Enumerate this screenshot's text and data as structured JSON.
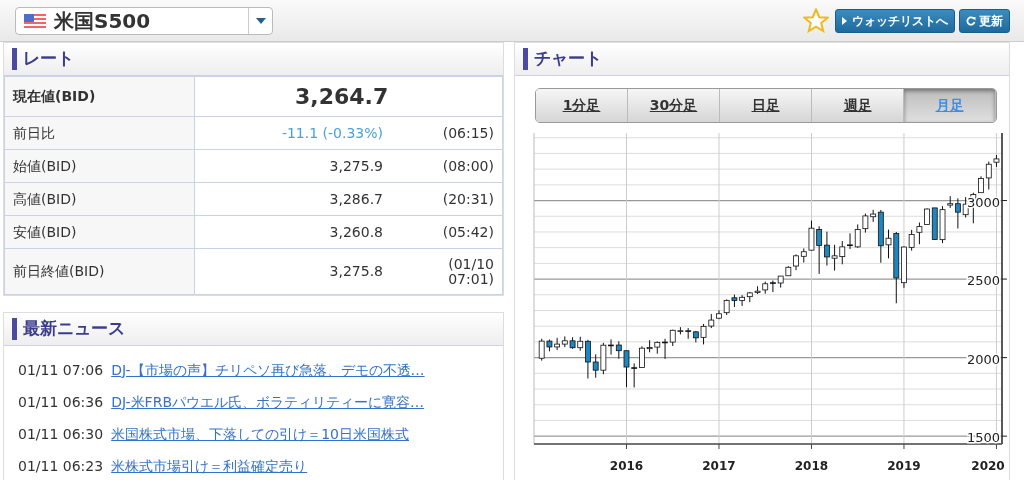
{
  "header": {
    "instrument": "米国S500",
    "watchlist_button": "ウォッチリストへ",
    "refresh_button": "更新"
  },
  "rate": {
    "title": "レート",
    "current": {
      "label": "現在値(BID)",
      "value": "3,264.7"
    },
    "rows": [
      {
        "label": "前日比",
        "value": "-11.1 (-0.33%)",
        "time": "(06:15)",
        "kind": "change"
      },
      {
        "label": "始値(BID)",
        "value": "3,275.9",
        "time": "(08:00)",
        "kind": "price"
      },
      {
        "label": "高値(BID)",
        "value": "3,286.7",
        "time": "(20:31)",
        "kind": "price"
      },
      {
        "label": "安値(BID)",
        "value": "3,260.8",
        "time": "(05:42)",
        "kind": "price"
      },
      {
        "label": "前日終値(BID)",
        "value": "3,275.8",
        "time": "(01/10 07:01)",
        "kind": "price"
      }
    ]
  },
  "news": {
    "title": "最新ニュース",
    "items": [
      {
        "time": "01/11 07:06",
        "title": "DJ-【市場の声】チリペソ再び急落、デモの不透…"
      },
      {
        "time": "01/11 06:36",
        "title": "DJ-米FRBパウエル氏、ボラティリティーに寛容…"
      },
      {
        "time": "01/11 06:30",
        "title": "米国株式市場、下落しての引け＝10日米国株式"
      },
      {
        "time": "01/11 06:23",
        "title": "米株式市場引け＝利益確定売り"
      }
    ]
  },
  "chart": {
    "title": "チャート",
    "tabs": [
      {
        "label": "1分足",
        "selected": false
      },
      {
        "label": "30分足",
        "selected": false
      },
      {
        "label": "日足",
        "selected": false
      },
      {
        "label": "週足",
        "selected": false
      },
      {
        "label": "月足",
        "selected": true
      }
    ],
    "chart_data": {
      "type": "candlestick",
      "grid": true,
      "x": [
        2015.083,
        2015.167,
        2015.25,
        2015.333,
        2015.417,
        2015.5,
        2015.583,
        2015.667,
        2015.75,
        2015.833,
        2015.917,
        2016,
        2016.083,
        2016.167,
        2016.25,
        2016.333,
        2016.417,
        2016.5,
        2016.583,
        2016.667,
        2016.75,
        2016.833,
        2016.917,
        2017,
        2017.083,
        2017.167,
        2017.25,
        2017.333,
        2017.417,
        2017.5,
        2017.583,
        2017.667,
        2017.75,
        2017.833,
        2017.917,
        2018,
        2018.083,
        2018.167,
        2018.25,
        2018.333,
        2018.417,
        2018.5,
        2018.583,
        2018.667,
        2018.75,
        2018.833,
        2018.917,
        2019,
        2019.083,
        2019.167,
        2019.25,
        2019.333,
        2019.417,
        2019.5,
        2019.583,
        2019.667,
        2019.75,
        2019.833,
        2019.917,
        2020
      ],
      "ohlc": [
        [
          1996,
          2120,
          1981,
          2105
        ],
        [
          2105,
          2115,
          2040,
          2068
        ],
        [
          2068,
          2126,
          2048,
          2086
        ],
        [
          2086,
          2135,
          2067,
          2107
        ],
        [
          2107,
          2130,
          2056,
          2063
        ],
        [
          2063,
          2133,
          2044,
          2104
        ],
        [
          2104,
          2113,
          1867,
          1972
        ],
        [
          1972,
          2021,
          1872,
          1920
        ],
        [
          1920,
          2094,
          1894,
          2079
        ],
        [
          2079,
          2116,
          2019,
          2080
        ],
        [
          2080,
          2104,
          1993,
          2044
        ],
        [
          2044,
          2044,
          1812,
          1940
        ],
        [
          1936,
          1963,
          1810,
          1932
        ],
        [
          1937,
          2072,
          1937,
          2060
        ],
        [
          2057,
          2111,
          2034,
          2065
        ],
        [
          2067,
          2103,
          2025,
          2097
        ],
        [
          2094,
          2120,
          1992,
          2099
        ],
        [
          2099,
          2178,
          2074,
          2174
        ],
        [
          2171,
          2194,
          2148,
          2171
        ],
        [
          2171,
          2188,
          2120,
          2168
        ],
        [
          2164,
          2170,
          2097,
          2126
        ],
        [
          2129,
          2214,
          2084,
          2199
        ],
        [
          2201,
          2278,
          2188,
          2239
        ],
        [
          2251,
          2301,
          2245,
          2279
        ],
        [
          2286,
          2371,
          2271,
          2364
        ],
        [
          2381,
          2401,
          2322,
          2363
        ],
        [
          2363,
          2398,
          2329,
          2384
        ],
        [
          2388,
          2418,
          2353,
          2412
        ],
        [
          2415,
          2454,
          2405,
          2423
        ],
        [
          2431,
          2484,
          2407,
          2470
        ],
        [
          2477,
          2491,
          2417,
          2472
        ],
        [
          2475,
          2519,
          2446,
          2519
        ],
        [
          2521,
          2582,
          2520,
          2575
        ],
        [
          2583,
          2657,
          2557,
          2648
        ],
        [
          2645,
          2695,
          2605,
          2674
        ],
        [
          2684,
          2873,
          2682,
          2824
        ],
        [
          2816,
          2836,
          2533,
          2714
        ],
        [
          2716,
          2802,
          2586,
          2641
        ],
        [
          2633,
          2718,
          2554,
          2648
        ],
        [
          2643,
          2742,
          2594,
          2705
        ],
        [
          2718,
          2791,
          2691,
          2718
        ],
        [
          2705,
          2848,
          2699,
          2816
        ],
        [
          2821,
          2917,
          2796,
          2902
        ],
        [
          2897,
          2941,
          2864,
          2914
        ],
        [
          2926,
          2940,
          2604,
          2712
        ],
        [
          2718,
          2815,
          2632,
          2760
        ],
        [
          2790,
          2800,
          2346,
          2507
        ],
        [
          2477,
          2708,
          2444,
          2704
        ],
        [
          2702,
          2813,
          2681,
          2784
        ],
        [
          2798,
          2860,
          2722,
          2834
        ],
        [
          2848,
          2950,
          2848,
          2946
        ],
        [
          2953,
          2954,
          2751,
          2752
        ],
        [
          2751,
          2964,
          2729,
          2942
        ],
        [
          2971,
          3028,
          2953,
          2980
        ],
        [
          2980,
          3014,
          2822,
          2926
        ],
        [
          2910,
          3022,
          2892,
          2977
        ],
        [
          2983,
          3050,
          2855,
          3038
        ],
        [
          3050,
          3154,
          3050,
          3141
        ],
        [
          3144,
          3248,
          3070,
          3231
        ],
        [
          3244,
          3290,
          3214,
          3265
        ]
      ],
      "ylim": [
        1450,
        3430
      ],
      "yticks": [
        1500,
        2000,
        2500,
        3000
      ],
      "xlim": [
        2015.0,
        2020.06
      ],
      "xticks": [
        2016,
        2017,
        2018,
        2019,
        2020
      ]
    }
  }
}
